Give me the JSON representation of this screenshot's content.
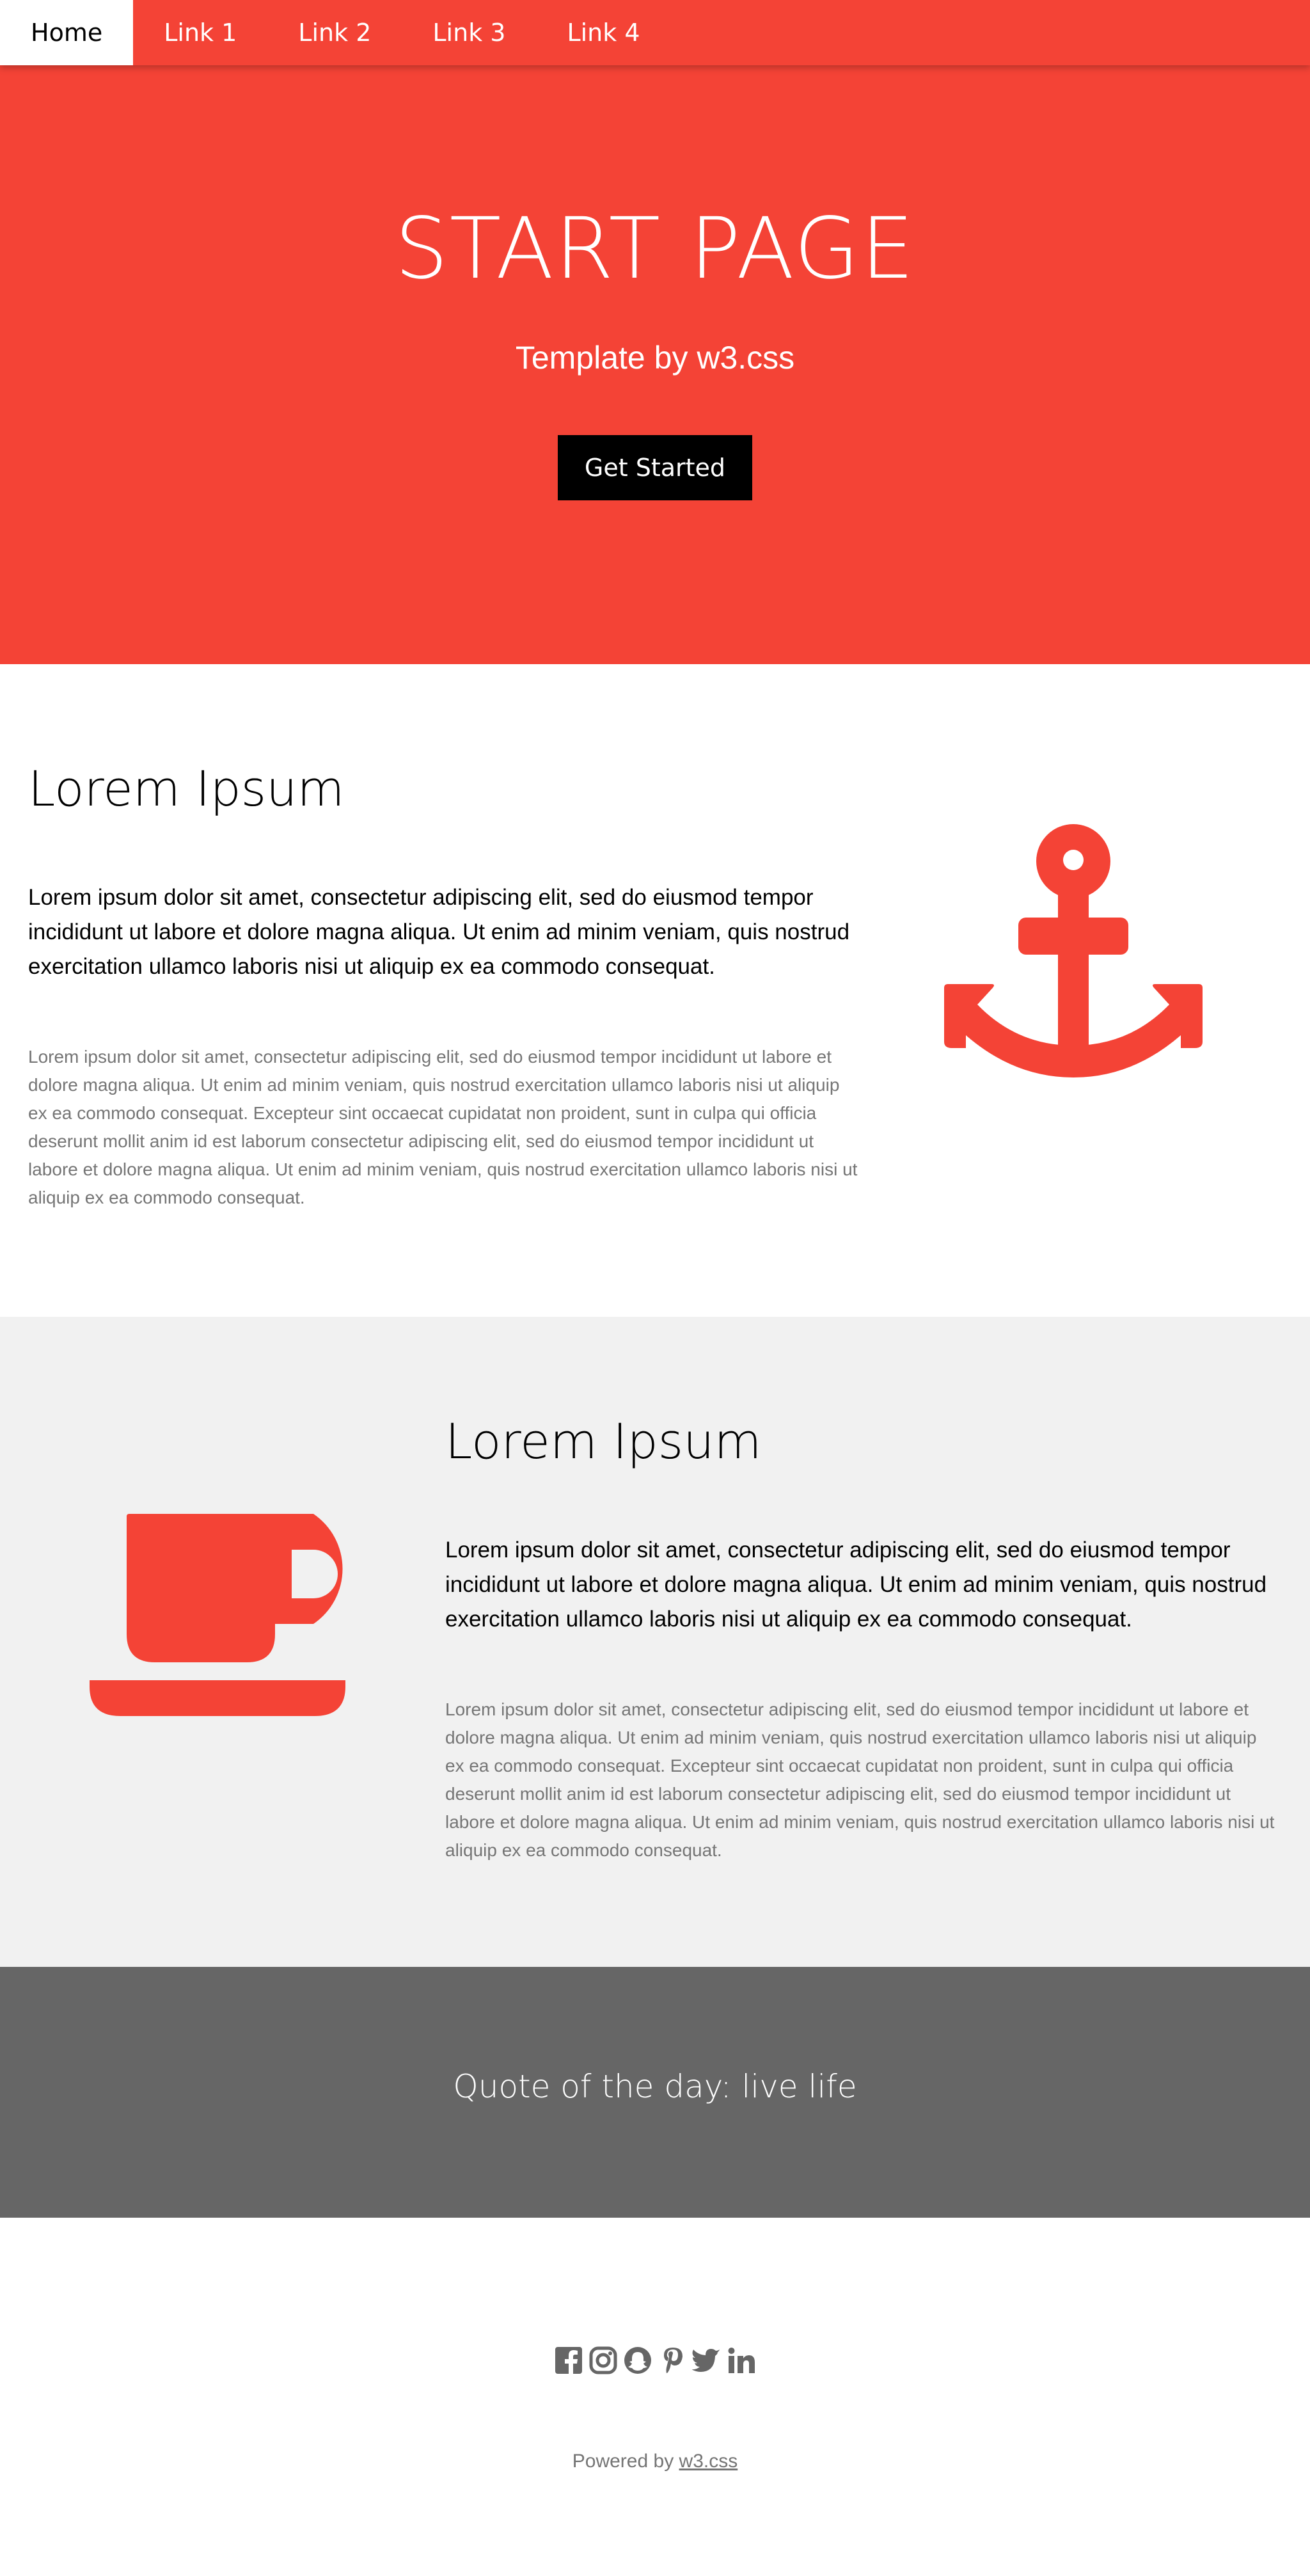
{
  "nav": {
    "items": [
      {
        "label": "Home",
        "active": true
      },
      {
        "label": "Link 1"
      },
      {
        "label": "Link 2"
      },
      {
        "label": "Link 3"
      },
      {
        "label": "Link 4"
      }
    ]
  },
  "hero": {
    "title": "START PAGE",
    "subtitle": "Template by w3.css",
    "button_label": "Get Started"
  },
  "section1": {
    "title": "Lorem Ipsum",
    "lead": "Lorem ipsum dolor sit amet, consectetur adipiscing elit, sed do eiusmod tempor incididunt ut labore et dolore magna aliqua. Ut enim ad minim veniam, quis nostrud exercitation ullamco laboris nisi ut aliquip ex ea commodo consequat.",
    "body": "Lorem ipsum dolor sit amet, consectetur adipiscing elit, sed do eiusmod tempor incididunt ut labore et dolore magna aliqua. Ut enim ad minim veniam, quis nostrud exercitation ullamco laboris nisi ut aliquip ex ea commodo consequat. Excepteur sint occaecat cupidatat non proident, sunt in culpa qui officia deserunt mollit anim id est laborum consectetur adipiscing elit, sed do eiusmod tempor incididunt ut labore et dolore magna aliqua. Ut enim ad minim veniam, quis nostrud exercitation ullamco laboris nisi ut aliquip ex ea commodo consequat.",
    "icon": "anchor-icon"
  },
  "section2": {
    "title": "Lorem Ipsum",
    "lead": "Lorem ipsum dolor sit amet, consectetur adipiscing elit, sed do eiusmod tempor incididunt ut labore et dolore magna aliqua. Ut enim ad minim veniam, quis nostrud exercitation ullamco laboris nisi ut aliquip ex ea commodo consequat.",
    "body": "Lorem ipsum dolor sit amet, consectetur adipiscing elit, sed do eiusmod tempor incididunt ut labore et dolore magna aliqua. Ut enim ad minim veniam, quis nostrud exercitation ullamco laboris nisi ut aliquip ex ea commodo consequat. Excepteur sint occaecat cupidatat non proident, sunt in culpa qui officia deserunt mollit anim id est laborum consectetur adipiscing elit, sed do eiusmod tempor incididunt ut labore et dolore magna aliqua. Ut enim ad minim veniam, quis nostrud exercitation ullamco laboris nisi ut aliquip ex ea commodo consequat.",
    "icon": "coffee-icon"
  },
  "quote": {
    "text": "Quote of the day: live life"
  },
  "footer": {
    "social_icons": [
      "facebook-icon",
      "instagram-icon",
      "snapchat-icon",
      "pinterest-icon",
      "twitter-icon",
      "linkedin-icon"
    ],
    "powered_prefix": "Powered by ",
    "powered_link": "w3.css"
  },
  "colors": {
    "accent": "#f44336",
    "quote_bg": "#666666",
    "section_alt_bg": "#f1f1f1",
    "muted_text": "#757575"
  }
}
